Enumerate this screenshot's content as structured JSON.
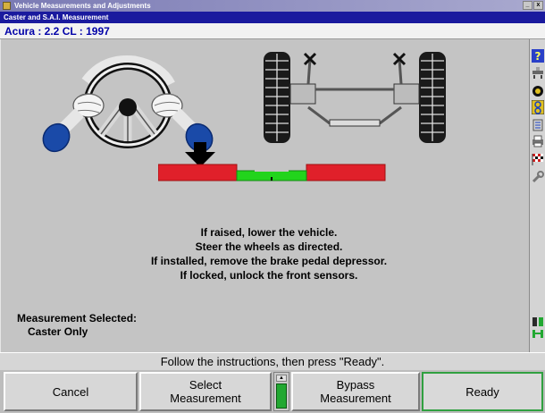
{
  "window": {
    "title": "Vehicle Measurements and Adjustments",
    "controls": [
      "_",
      "x"
    ]
  },
  "dialog": {
    "title": "Caster and S.A.I. Measurement"
  },
  "vehicle": {
    "name": "Acura : 2.2 CL : 1997"
  },
  "instructions": [
    "If raised, lower the vehicle.",
    "Steer the wheels as directed.",
    "If installed, remove the brake pedal depressor.",
    "If locked, unlock the front sensors."
  ],
  "measurement": {
    "label": "Measurement Selected:",
    "value": "Caster Only"
  },
  "status": "Follow the instructions, then press \"Ready\".",
  "buttons": {
    "cancel": "Cancel",
    "select_line1": "Select",
    "select_line2": "Measurement",
    "bypass_line1": "Bypass",
    "bypass_line2": "Measurement",
    "ready": "Ready"
  },
  "toolbar_icons": [
    "help-icon",
    "vehicle-lift-icon",
    "tire-icon",
    "wheel-sensor-icon",
    "caster-icon",
    "printer-icon",
    "checkered-flag-icon",
    "wrench-icon"
  ],
  "colors": {
    "indicator_red": "#e0202a",
    "indicator_green": "#22d41c",
    "title_blue": "#1a1a9e",
    "vehicle_text": "#0000a8"
  }
}
